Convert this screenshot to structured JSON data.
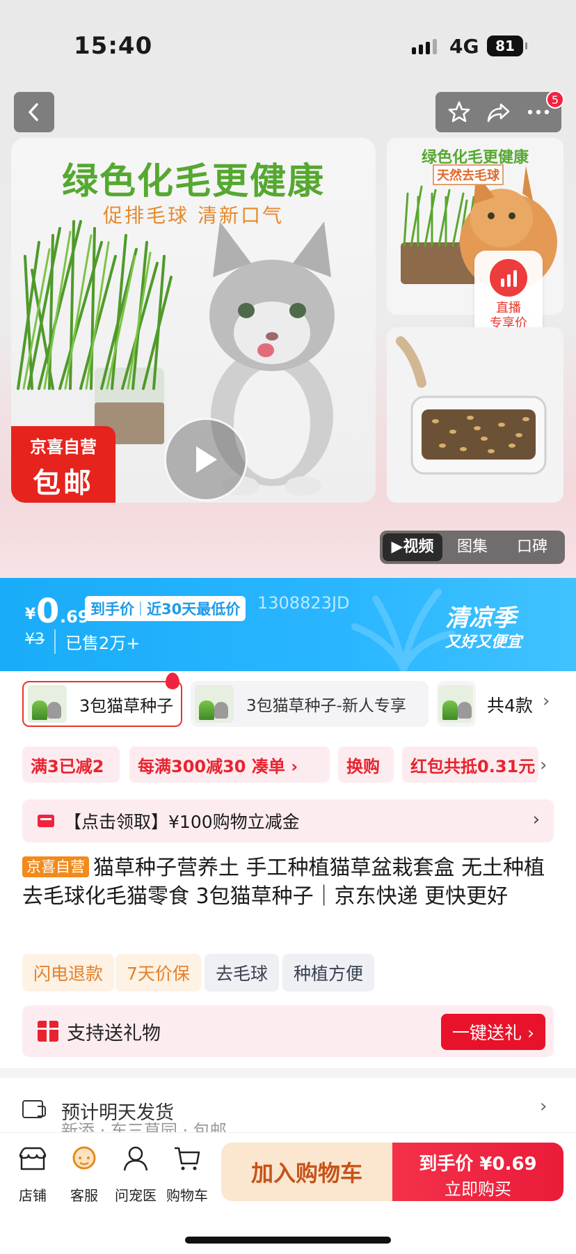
{
  "status": {
    "time": "15:40",
    "network": "4G",
    "battery": "81"
  },
  "nav": {
    "badge_count": "5"
  },
  "hero": {
    "main_title": "绿色化毛更健康",
    "main_subtitle": "促排毛球  清新口气",
    "badge_top": "京喜自营",
    "badge_bottom": "包邮",
    "side_title": "绿色化毛更健康",
    "side_tag": "天然去毛球",
    "live_l1": "直播",
    "live_l2": "专享价",
    "media_tabs": [
      "▶视频",
      "图集",
      "口碑"
    ]
  },
  "price": {
    "symbol": "¥",
    "integer": "0",
    "decimal": ".69",
    "tag_a": "到手价",
    "tag_b": "近30天最低价",
    "code": "1308823JD",
    "original": "¥3",
    "sold": "已售2万+",
    "season_title": "清凉季",
    "season_sub": "又好又便宜"
  },
  "sku": {
    "items": [
      "3包猫草种子",
      "3包猫草种子-新人专享",
      ""
    ],
    "count": "共4款"
  },
  "promos": [
    "满3已减2",
    "每满300减30  凑单 ›",
    "换购",
    "红包共抵0.31元"
  ],
  "coupon": {
    "bracket": "【点击领取】",
    "text": "¥100购物立减金"
  },
  "title": {
    "tag": "京喜自营",
    "text": "猫草种子营养土 手工种植猫草盆栽套盒 无土种植去毛球化毛猫零食 3包猫草种子｜京东快递 更快更好"
  },
  "features": [
    "闪电退款",
    "7天价保",
    "去毛球",
    "种植方便"
  ],
  "gift": {
    "text": "支持送礼物",
    "button": "一键送礼 ›"
  },
  "shipping": {
    "text": "预计明天发货",
    "sub": "新添 · 东三草园 · 包邮"
  },
  "bottom": {
    "icons": [
      "店铺",
      "客服",
      "问宠医",
      "购物车"
    ],
    "add_cart": "加入购物车",
    "buy_l1": "到手价 ¥0.69",
    "buy_l2": "立即购买"
  },
  "colors": {
    "accent": "#E8232F",
    "banner": "#2AB6FF",
    "orange": "#F28A1C",
    "green": "#55A830"
  }
}
